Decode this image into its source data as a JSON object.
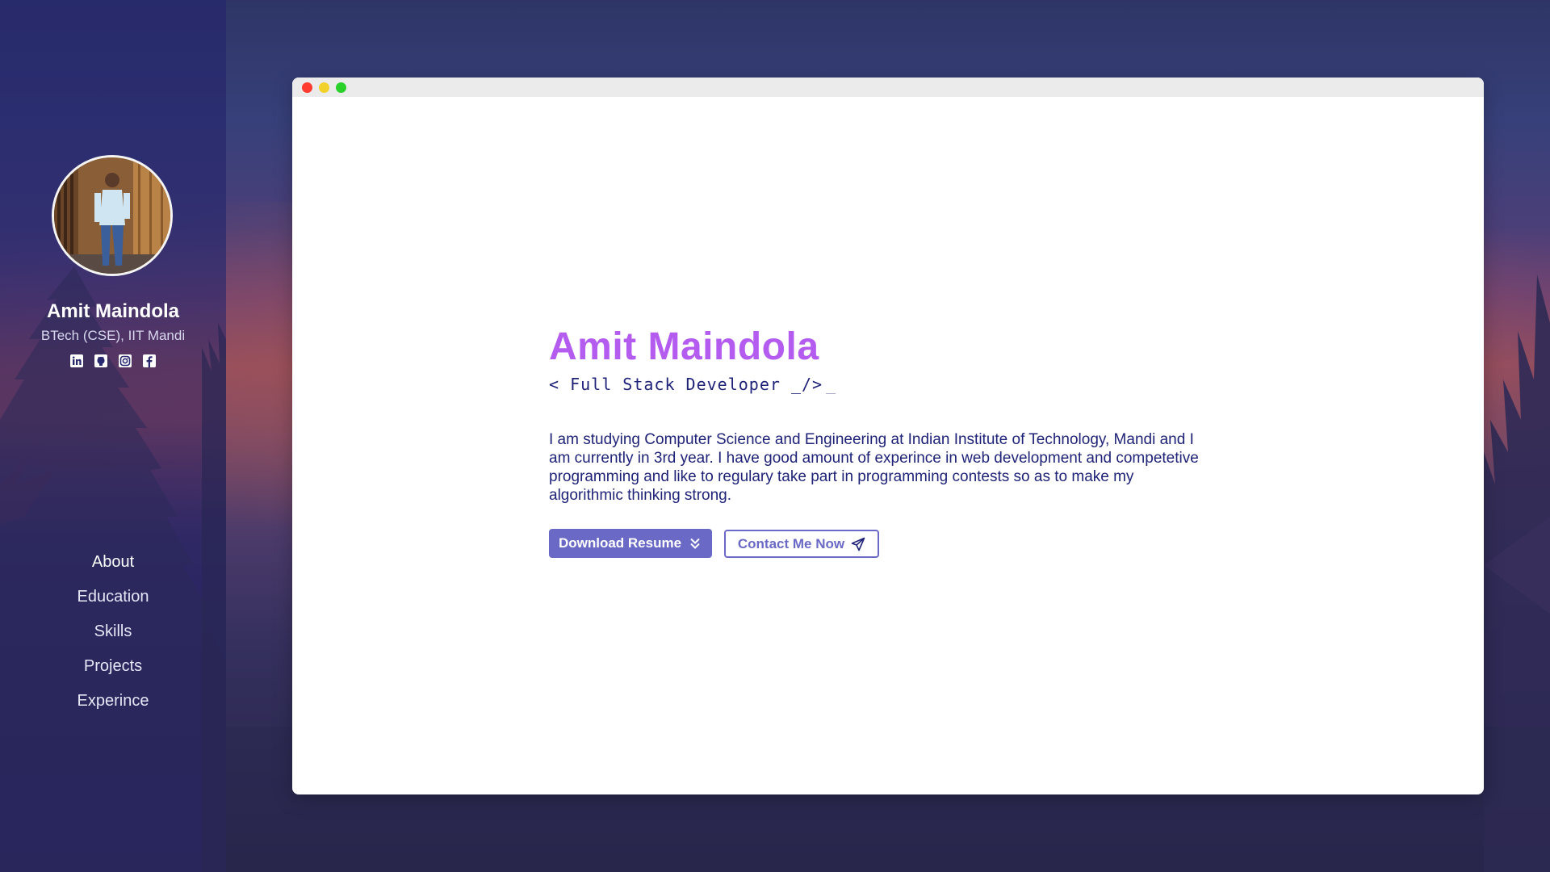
{
  "sidebar": {
    "name": "Amit Maindola",
    "subtitle": "BTech (CSE), IIT Mandi",
    "socials": [
      {
        "icon": "linkedin-icon"
      },
      {
        "icon": "github-icon"
      },
      {
        "icon": "instagram-icon"
      },
      {
        "icon": "facebook-icon"
      }
    ],
    "nav": [
      {
        "label": "About",
        "active": true
      },
      {
        "label": "Education"
      },
      {
        "label": "Skills"
      },
      {
        "label": "Projects"
      },
      {
        "label": "Experince"
      }
    ]
  },
  "main": {
    "title": "Amit Maindola",
    "role": "< Full Stack Developer _/>",
    "cursor": "_",
    "bio": "I am studying Computer Science and Engineering at Indian Institute of Technology, Mandi and I am currently in 3rd year. I have good amount of experince in web development and competetive programming and like to regulary take part in programming contests so as to make my algorithmic thinking strong.",
    "buttons": {
      "download_label": "Download Resume",
      "download_icon": "double-chevron-down-icon",
      "contact_label": "Contact Me Now",
      "contact_icon": "paper-plane-icon"
    }
  },
  "colors": {
    "accent_title": "#b45cf0",
    "text": "#1f2378",
    "button": "#6a6ac6"
  }
}
